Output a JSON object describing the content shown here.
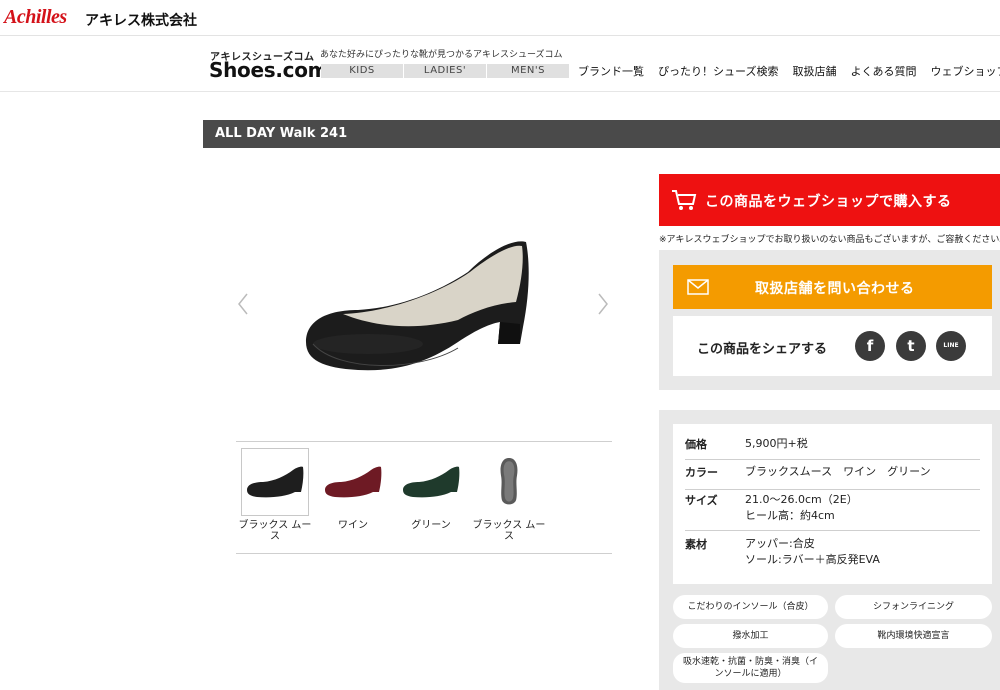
{
  "corp": {
    "brand": "Achilles",
    "brand_jp": "アキレス株式会社"
  },
  "site": {
    "logo_small": "アキレスシューズコム",
    "logo_big": "Shoes.com",
    "tagline": "あなた好みにぴったりな靴が見つかるアキレスシューズコム",
    "categories": [
      "KIDS",
      "LADIES'",
      "MEN'S"
    ],
    "nav": [
      "ブランド一覧",
      "ぴったり！シューズ検索",
      "取扱店舗",
      "よくある質問",
      "ウェブショップ"
    ]
  },
  "product": {
    "title": "ALL DAY Walk 241",
    "thumbnails": [
      {
        "label": "ブラックス ムース",
        "color": "#1e1e1e"
      },
      {
        "label": "ワイン",
        "color": "#6e1a24"
      },
      {
        "label": "グリーン",
        "color": "#1f3a2c"
      },
      {
        "label": "ブラックス ムース",
        "color": "#5a5a5a"
      }
    ]
  },
  "actions": {
    "buy_label": "この商品をウェブショップで購入する",
    "buy_note": "※アキレスウェブショップでお取り扱いのない商品もございますが、ご容赦ください。",
    "inquire_label": "取扱店舗を問い合わせる",
    "share_label": "この商品をシェアする",
    "sns": [
      {
        "name": "facebook",
        "glyph": "f"
      },
      {
        "name": "twitter",
        "glyph": "t"
      },
      {
        "name": "line",
        "glyph": "LINE"
      }
    ]
  },
  "specs": {
    "price_k": "価格",
    "price_v": "5,900円+税",
    "color_k": "カラー",
    "color_v": "ブラックスムース　ワイン　グリーン",
    "size_k": "サイズ",
    "size_v1": "21.0〜26.0cm（2E）",
    "size_v2": "ヒール高：約4cm",
    "material_k": "素材",
    "material_v1": "アッパー:合皮",
    "material_v2": "ソール:ラバー＋高反発EVA"
  },
  "features": [
    "こだわりのインソール（合皮）",
    "シフォンライニング",
    "撥水加工",
    "靴内環境快適宣言",
    "吸水速乾・抗菌・防臭・消臭（インソールに適用）"
  ],
  "colors": {
    "buy": "#ee1111",
    "inquire": "#f49b00",
    "title_bar": "#4a4a4a",
    "brand": "#d4121a"
  }
}
